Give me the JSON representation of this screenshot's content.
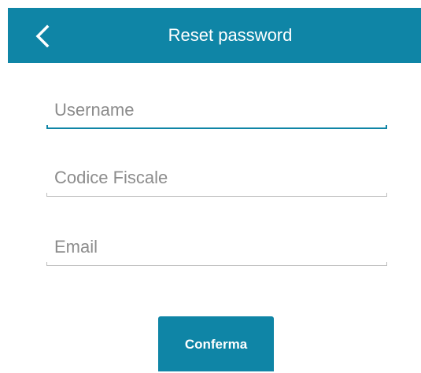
{
  "header": {
    "title": "Reset password",
    "back_icon": "chevron-left-icon"
  },
  "form": {
    "username": {
      "placeholder": "Username",
      "value": ""
    },
    "codice_fiscale": {
      "placeholder": "Codice Fiscale",
      "value": ""
    },
    "email": {
      "placeholder": "Email",
      "value": ""
    },
    "submit_label": "Conferma"
  },
  "colors": {
    "accent": "#0f85a6",
    "underline": "#bdbdbd",
    "placeholder": "#8c8c8c"
  }
}
